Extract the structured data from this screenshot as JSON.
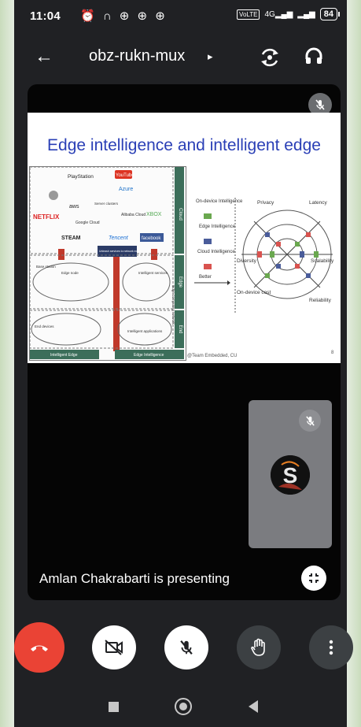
{
  "status_bar": {
    "time": "11:04",
    "notification_glyphs": "⏰ ∩ ⊕ ⊕ ⊕",
    "volte_label": "VoLTE",
    "network_label": "4G",
    "battery": "84"
  },
  "header": {
    "meeting_code": "obz-rukn-mux",
    "caret": "▸"
  },
  "slide": {
    "title": "Edge intelligence and intelligent edge",
    "left_figure": {
      "cloud_label": "Cloud",
      "edge_label": "Edge",
      "end_label": "End",
      "platforms": [
        "PlayStation",
        "YouTube",
        "Azure",
        "aws",
        "Server clusters",
        "Alibaba Cloud",
        "XBOX",
        "NETFLIX",
        "Google Cloud",
        "STEAM",
        "Tencent",
        "facebook"
      ],
      "unleash_text": "Unleash services to network edge",
      "base_station": "Base station",
      "edge_node": "Edge node",
      "intelligent_services": "Intelligent services",
      "end_devices": "End devices",
      "intelligent_applications": "Intelligent applications",
      "bottom_left": "Intelligent Edge",
      "bottom_right": "Edge Intelligence",
      "side_text": "Edge computing network"
    },
    "right_figure": {
      "legend": [
        "On-device Intelligence",
        "Edge Intelligence",
        "Cloud Intelligence",
        "Better"
      ],
      "axes": [
        "Privacy",
        "Latency",
        "Diversity",
        "Scalability",
        "On-device cost",
        "Reliability"
      ]
    },
    "footer": "@Team Embedded, CU",
    "page": "8"
  },
  "presenter": {
    "text": "Amlan Chakrabarti is presenting",
    "avatar_letter": "S"
  },
  "colors": {
    "end_call": "#ea4335",
    "background": "#202124",
    "slide_title": "#2a3fb6"
  },
  "icons": {
    "back": "arrow-left",
    "switch_camera": "camera-switch",
    "audio": "headphones",
    "mic_off": "mic-off",
    "video_off": "videocam-off",
    "raise_hand": "hand",
    "more": "more-vertical",
    "end_call": "phone-hangup",
    "collapse": "collapse"
  }
}
